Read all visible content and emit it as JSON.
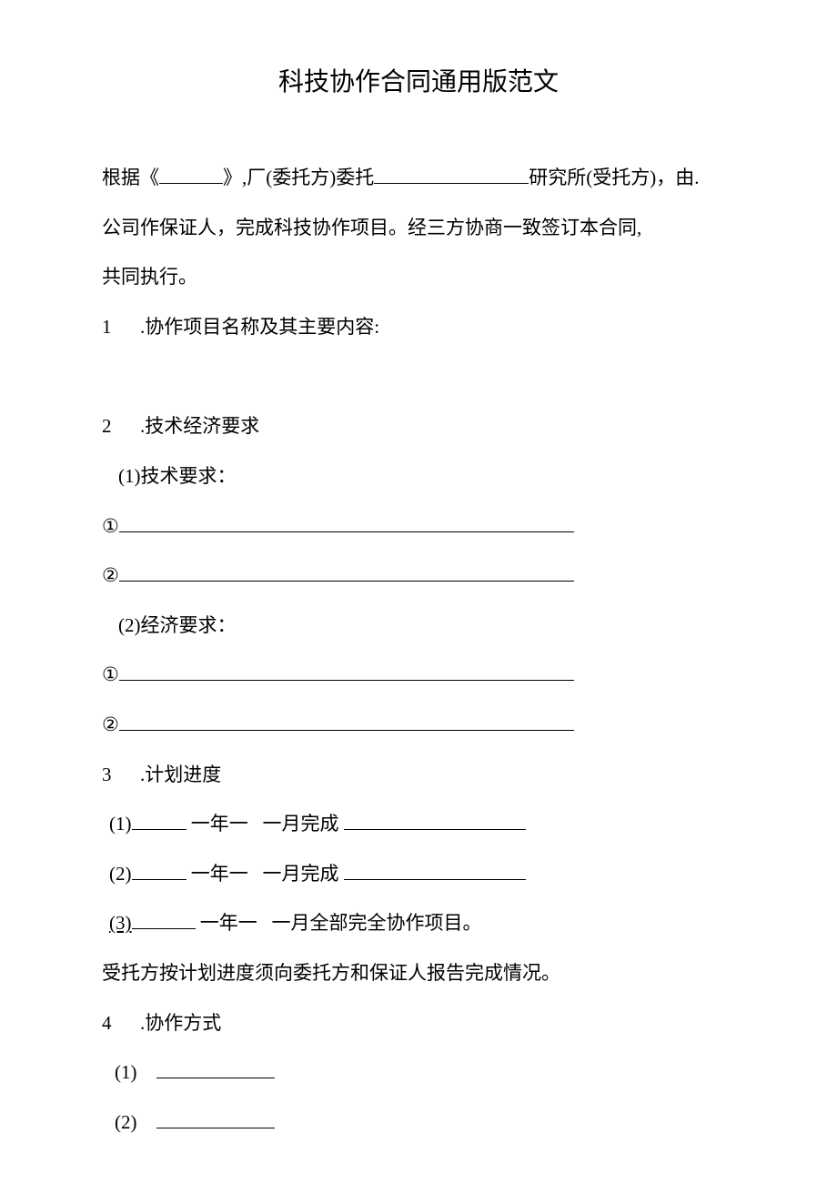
{
  "title": "科技协作合同通用版范文",
  "intro": {
    "l1_a": "根据《",
    "l1_b": "》,厂(委托方)委托",
    "l1_c": "研究所(受托方)，由.",
    "l2": "公司作保证人，完成科技协作项目。经三方协商一致签订本合同,",
    "l3": "共同执行。"
  },
  "s1": {
    "num": "1",
    "dot": ".协作项目名称及其主要内容:"
  },
  "s2": {
    "num": "2",
    "dot": ".技术经济要求",
    "t_label": "(1)技术要求：",
    "b1": "①",
    "b2": "②",
    "e_label": "(2)经济要求：",
    "e1": "①",
    "e2": "②"
  },
  "s3": {
    "num": "3",
    "dot": ".计划进度",
    "r1_a": "(1)",
    "r1_b": "一年一",
    "r1_c": "一月完成",
    "r2_a": "(2)",
    "r2_b": "一年一",
    "r2_c": "一月完成",
    "r3_a": "(3)",
    "r3_b": "一年一",
    "r3_c": "一月全部完全协作项目。",
    "note": "受托方按计划进度须向委托方和保证人报告完成情况。"
  },
  "s4": {
    "num": "4",
    "dot": ".协作方式",
    "i1": "(1)",
    "i2": "(2)"
  }
}
